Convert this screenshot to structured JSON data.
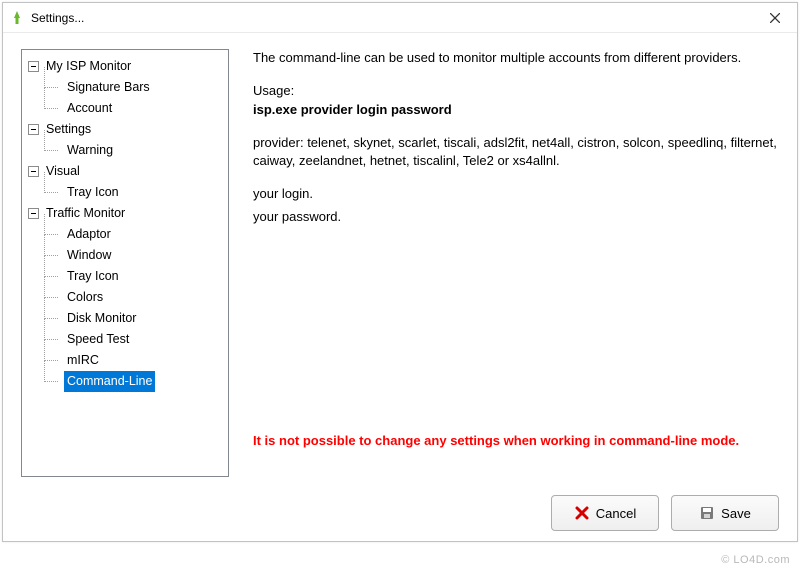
{
  "window": {
    "title": "Settings..."
  },
  "tree": {
    "items": [
      {
        "label": "My ISP Monitor",
        "expandable": true
      },
      {
        "label": "Signature Bars",
        "child": true
      },
      {
        "label": "Account",
        "child": true
      },
      {
        "label": "Settings",
        "expandable": true
      },
      {
        "label": "Warning",
        "child": true
      },
      {
        "label": "Visual",
        "expandable": true
      },
      {
        "label": "Tray Icon",
        "child": true
      },
      {
        "label": "Traffic Monitor",
        "expandable": true
      },
      {
        "label": "Adaptor",
        "child": true
      },
      {
        "label": "Window",
        "child": true
      },
      {
        "label": "Tray Icon",
        "child": true
      },
      {
        "label": "Colors",
        "child": true
      },
      {
        "label": "Disk Monitor",
        "child": true
      },
      {
        "label": "Speed Test",
        "child": true
      },
      {
        "label": "mIRC",
        "child": true
      },
      {
        "label": "Command-Line",
        "child": true,
        "selected": true
      }
    ]
  },
  "detail": {
    "intro": "The command-line can be used to monitor multiple accounts from different providers.",
    "usage_label": "Usage:",
    "usage_cmd": "isp.exe provider login password",
    "providers": "provider: telenet, skynet, scarlet, tiscali, adsl2fit, net4all, cistron, solcon, speedlinq, filternet, caiway, zeelandnet, hetnet, tiscalinl, Tele2 or xs4allnl.",
    "login": "your login.",
    "password": "your password.",
    "warning": "It is not possible to change any settings when working in command-line mode."
  },
  "buttons": {
    "cancel": "Cancel",
    "save": "Save"
  },
  "watermark": "© LO4D.com"
}
